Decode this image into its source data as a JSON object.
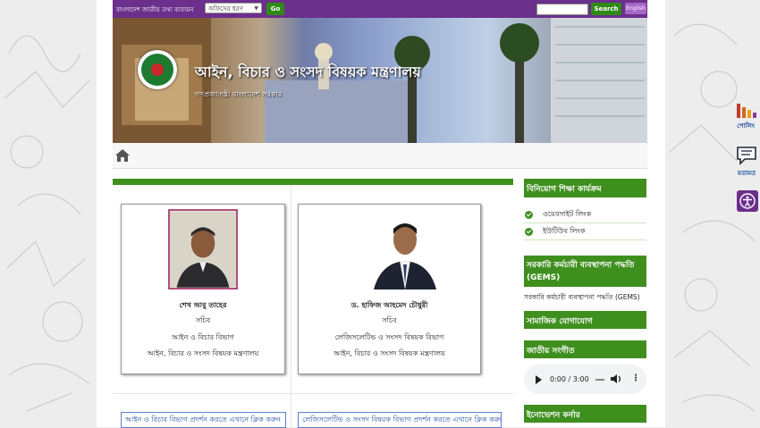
{
  "topbar": {
    "portal_title": "বাংলাদেশ জাতীয় তথ্য বাতায়ন",
    "office_select": "অফিসের ধরণ",
    "go_label": "Go",
    "search_label": "Search",
    "lang_label": "English"
  },
  "banner": {
    "title": "আইন, বিচার ও সংসদ বিষয়ক মন্ত্রণালয়",
    "subtitle": "গণপ্রজাতন্ত্রী বাংলাদেশ সরকার"
  },
  "officials": [
    {
      "name": "শেখ আবু তাহের",
      "designation": "সচিব",
      "division": "আইন ও বিচার বিভাগ",
      "ministry": "আইন, বিচার ও সংসদ বিষয়ক মন্ত্রণালয়"
    },
    {
      "name": "ড. হাফিজ আহমেদ চৌধুরী",
      "designation": "সচিব",
      "division": "লেজিসলেটিভ ও সংসদ বিষয়ক বিভাগ",
      "ministry": "আইন, বিচার ও সংসদ বিষয়ক মন্ত্রণালয়"
    }
  ],
  "display_links": [
    "আইন ও বিচার বিভাগ প্রদর্শন করতে এখানে ক্লিক করুন",
    "লেজিসলেটিভ ও সংসদ বিষয়ক বিভাগ প্রদর্শন করতে এখানে ক্লিক করুন"
  ],
  "sidebar": {
    "investment_title": "বিনিয়োগ শিক্ষা কার্যক্রম",
    "investment_links": [
      "ওয়েবসাইট লিংক",
      "ইউটিউব লিংক"
    ],
    "gems_title": "সরকারি কর্মচারী ব্যবস্থাপনা পদ্ধতি (GEMS)",
    "gems_text": "সরকারি কর্মচারী ব্যবস্থাপনা পদ্ধতি (GEMS)",
    "social_title": "সামাজিক যোগাযোগ",
    "anthem_title": "জাতীয় সংগীত",
    "audio_time": "0:00 / 3:00",
    "innovation_title": "ইনোভেশন কর্নার"
  },
  "widgets": {
    "poll_label": "পোলিং",
    "feedback_label": "মতামত"
  },
  "colors": {
    "topbar": "#6b2f8c",
    "green": "#3f8f1f",
    "link_blue": "#2450a8"
  },
  "icons": [
    "home-icon",
    "checkmark-icon",
    "play-icon",
    "volume-icon",
    "more-icon",
    "poll-icon",
    "chat-icon",
    "accessibility-icon"
  ]
}
